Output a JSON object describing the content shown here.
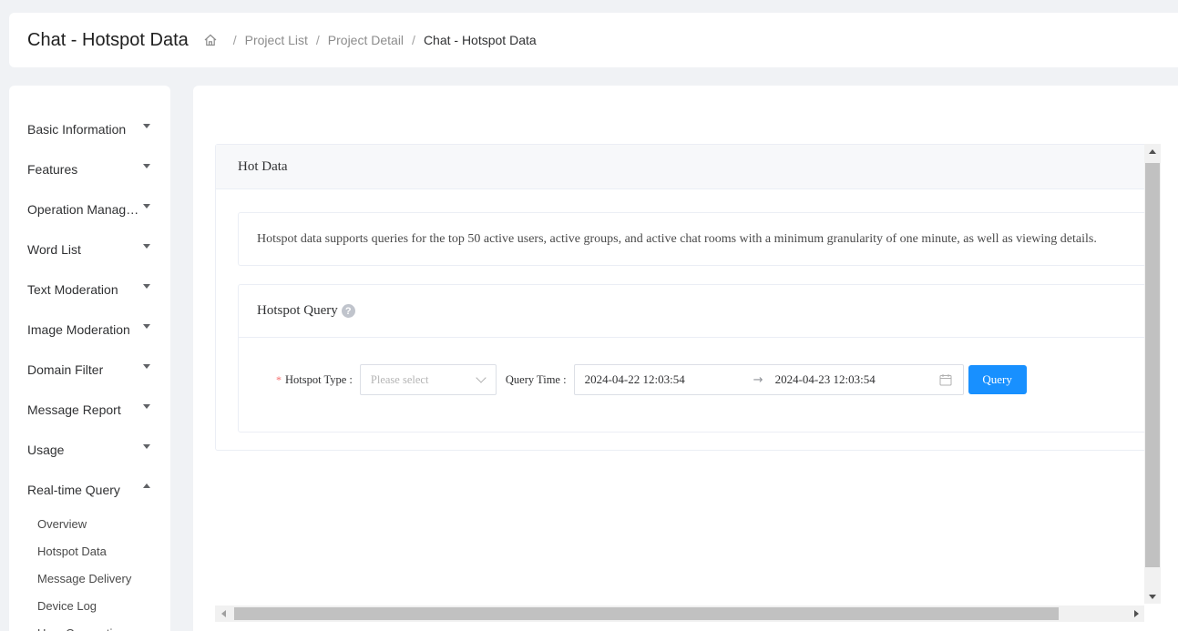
{
  "header": {
    "title": "Chat - Hotspot Data",
    "breadcrumb": [
      {
        "label": "Project List"
      },
      {
        "label": "Project Detail"
      },
      {
        "label": "Chat - Hotspot Data"
      }
    ],
    "home_icon": "home-icon",
    "separator": "/"
  },
  "sidebar": {
    "items": [
      {
        "label": "Basic Information"
      },
      {
        "label": "Features"
      },
      {
        "label": "Operation Management"
      },
      {
        "label": "Word List"
      },
      {
        "label": "Text Moderation"
      },
      {
        "label": "Image Moderation"
      },
      {
        "label": "Domain Filter"
      },
      {
        "label": "Message Report"
      },
      {
        "label": "Usage"
      },
      {
        "label": "Real-time Query",
        "expanded": true
      }
    ],
    "sub_items": [
      {
        "label": "Overview"
      },
      {
        "label": "Hotspot Data",
        "active": true
      },
      {
        "label": "Message Delivery"
      },
      {
        "label": "Device Log"
      },
      {
        "label": "User Connectio"
      }
    ]
  },
  "main": {
    "panel_title": "Hot Data",
    "info_text": "Hotspot data supports queries for the top 50 active users, active groups, and active chat rooms with a minimum granularity of one minute, as well as viewing details.",
    "query_title": "Hotspot Query",
    "help_icon": "?",
    "form": {
      "required_mark": "*",
      "hotspot_type_label": "Hotspot Type :",
      "hotspot_type_placeholder": "Please select",
      "query_time_label": "Query Time :",
      "start_time": "2024-04-22 12:03:54",
      "range_separator": "→",
      "end_time": "2024-04-23 12:03:54",
      "query_button": "Query"
    }
  },
  "colors": {
    "primary": "#1890ff",
    "required": "#f56c6c",
    "page_bg": "#f0f2f5"
  }
}
